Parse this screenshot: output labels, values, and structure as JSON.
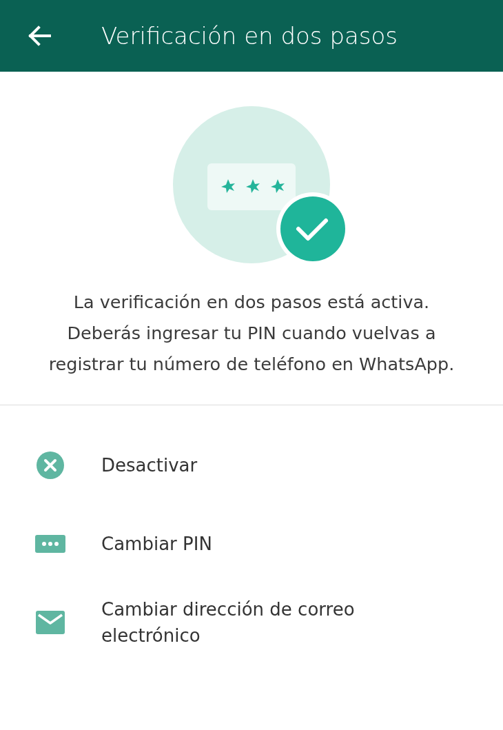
{
  "app_bar": {
    "title": "Verificación en dos pasos"
  },
  "description": "La verificación en dos pasos está activa. Deberás ingresar tu PIN cuando vuelvas a registrar tu número de teléfono en WhatsApp.",
  "options": [
    {
      "kind": "disable",
      "label": "Desactivar"
    },
    {
      "kind": "pin",
      "label": "Cambiar PIN"
    },
    {
      "kind": "email",
      "label": "Cambiar dirección de correo electrónico"
    }
  ]
}
